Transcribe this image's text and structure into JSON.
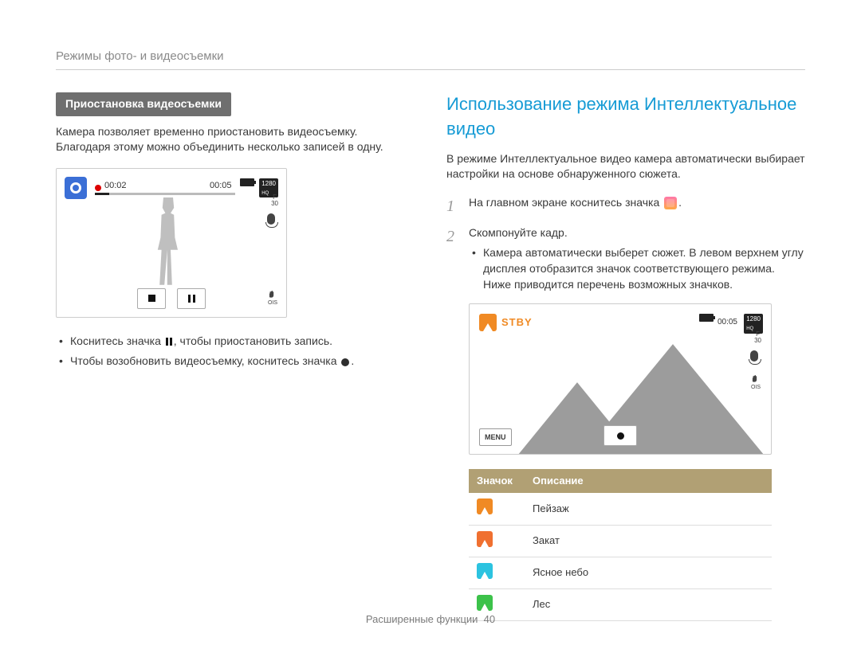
{
  "breadcrumb": "Режимы фото- и видеосъемки",
  "left": {
    "block_title": "Приостановка видеосъемки",
    "paragraph": "Камера позволяет временно приостановить видеосъемку. Благодаря этому можно объединить несколько записей в одну.",
    "screenshot": {
      "time_elapsed": "00:02",
      "time_total": "00:05",
      "resolution": "1280",
      "res_sub": "HQ",
      "fps_top": "F",
      "fps_bottom": "30",
      "ois": "OIS"
    },
    "bullet1_a": "Коснитесь значка",
    "bullet1_b": ", чтобы приостановить запись.",
    "bullet2_a": "Чтобы возобновить видеосъемку, коснитесь значка",
    "bullet2_b": "."
  },
  "right": {
    "heading": "Использование режима Интеллектуальное видео",
    "intro": "В режиме Интеллектуальное видео камера автоматически выбирает настройки на основе обнаруженного сюжета.",
    "steps": {
      "s1_a": "На главном экране коснитесь значка",
      "s1_b": ".",
      "s2": "Скомпонуйте кадр.",
      "s2_sub": "Камера автоматически выберет сюжет. В левом верхнем углу дисплея отобразится значок соответствующего режима. Ниже приводится перечень возможных значков."
    },
    "screenshot2": {
      "stby": "STBY",
      "time": "00:05",
      "res": "1280",
      "res_sub": "HQ",
      "fps_top": "F",
      "fps_bottom": "30",
      "menu": "MENU",
      "ois": "OIS"
    },
    "table": {
      "h1": "Значок",
      "h2": "Описание",
      "rows": [
        {
          "color": "orange",
          "label": "Пейзаж"
        },
        {
          "color": "orange2",
          "label": "Закат"
        },
        {
          "color": "cyan",
          "label": "Ясное небо"
        },
        {
          "color": "green",
          "label": "Лес"
        }
      ]
    }
  },
  "footer": {
    "text": "Расширенные функции",
    "page": "40"
  }
}
